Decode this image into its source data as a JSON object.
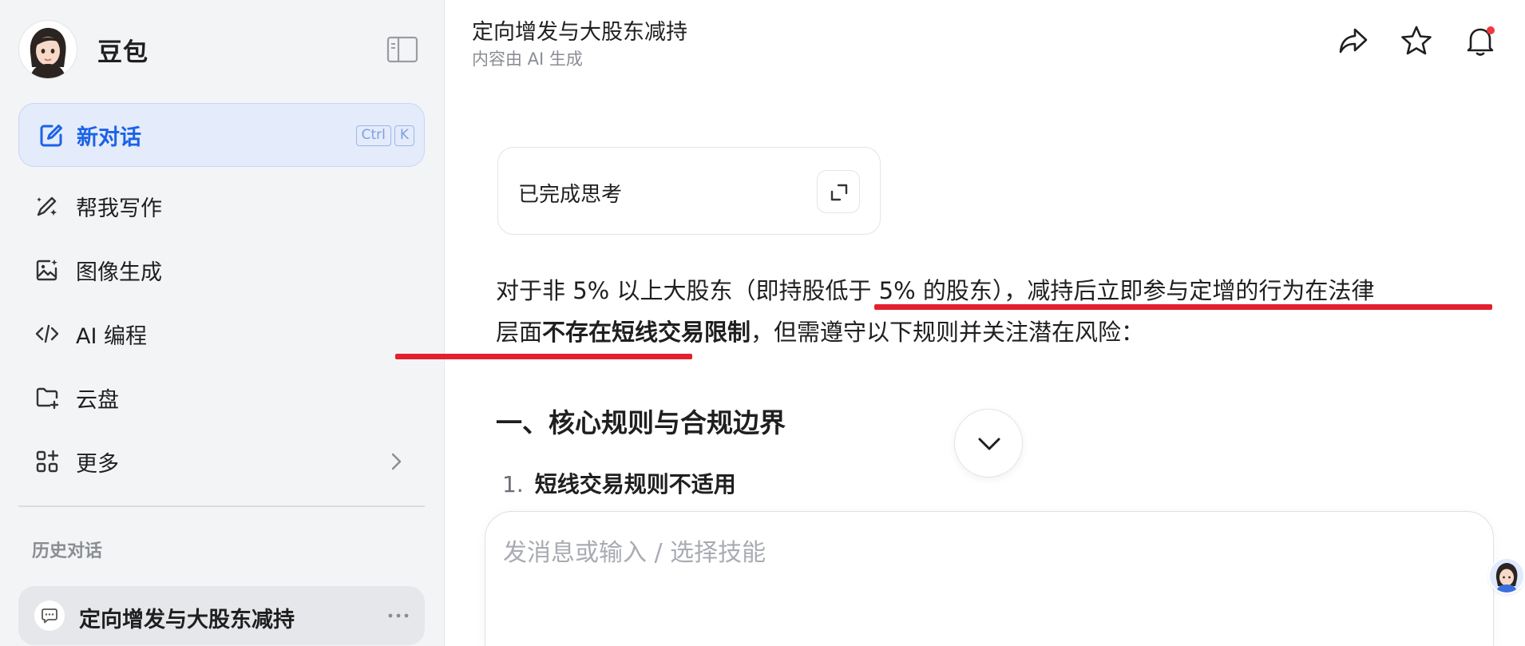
{
  "sidebar": {
    "brand_name": "豆包",
    "new_chat": {
      "label": "新对话",
      "shortcut": [
        "Ctrl",
        "K"
      ]
    },
    "nav_items": [
      {
        "label": "帮我写作",
        "icon": "pen-sparkle-icon"
      },
      {
        "label": "图像生成",
        "icon": "image-sparkle-icon"
      },
      {
        "label": "AI 编程",
        "icon": "code-icon"
      },
      {
        "label": "云盘",
        "icon": "folder-add-icon"
      },
      {
        "label": "更多",
        "icon": "apps-icon"
      }
    ],
    "history_title": "历史对话",
    "history_items": [
      {
        "label": "定向增发与大股东减持",
        "icon": "chat-bubble-icon",
        "active": true
      }
    ]
  },
  "header": {
    "title": "定向增发与大股东减持",
    "subtitle": "内容由 AI 生成",
    "actions": [
      "share-icon",
      "star-icon",
      "bell-icon"
    ],
    "has_notification": true
  },
  "thinking": {
    "label": "已完成思考"
  },
  "answer": {
    "p1_a": "对于非 5% 以上大股东（即持股低于 5% 的股东），",
    "p1_b": "减持后立即参与定增的行为在法律",
    "p1_c": "层面",
    "p1_d": "不存在短线交易限制",
    "p1_e": "，但需遵守以下规则并关注潜在风险："
  },
  "section": {
    "heading": "一、核心规则与合规边界",
    "items": [
      {
        "num": "1.",
        "text": "短线交易规则不适用"
      }
    ]
  },
  "composer": {
    "placeholder": "发消息或输入 / 选择技能",
    "value": ""
  },
  "colors": {
    "accent": "#1b63e6",
    "annotation_red": "#e3202f",
    "notification": "#f0383e"
  }
}
